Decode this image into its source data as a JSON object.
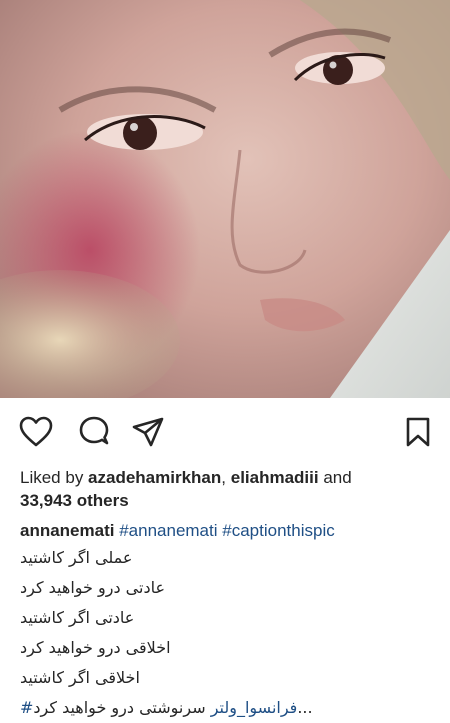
{
  "post": {
    "photo_icon": "selfie-photo",
    "actions": {
      "like_icon": "heart-icon",
      "comment_icon": "comment-icon",
      "share_icon": "share-icon",
      "save_icon": "bookmark-icon"
    },
    "likes": {
      "prefix": "Liked by ",
      "user1": "azadehamirkhan",
      "separator": ", ",
      "user2": "eliahmadiii",
      "and": " and ",
      "count": "33,943 others"
    },
    "caption": {
      "username": "annanemati",
      "hashtag1": "#annanemati",
      "hashtag2": "#captionthispic",
      "lines": [
        "عملی اگر کاشتید",
        "عادتی درو خواهید کرد",
        "عادتی اگر کاشتید",
        "اخلاقی درو خواهید کرد",
        "اخلاقی اگر کاشتید"
      ],
      "last_line_text": "سرنوشتی درو خواهید کرد...",
      "last_line_tag": "#فرانسوا_ولتر"
    }
  },
  "colors": {
    "text": "#262626",
    "link": "#1f4f85",
    "background": "#ffffff"
  }
}
